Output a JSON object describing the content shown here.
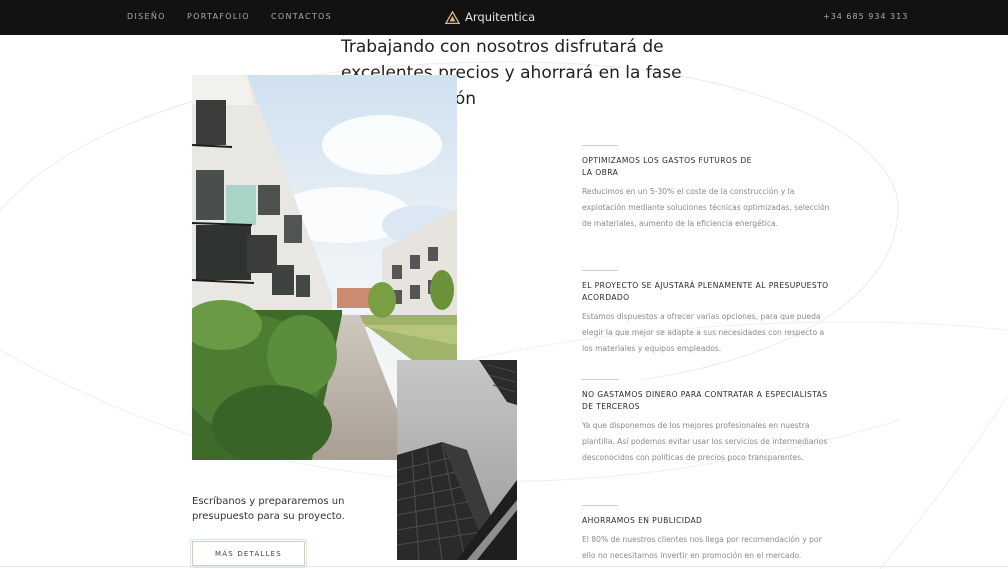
{
  "nav": {
    "links": [
      "DISEÑO",
      "PORTAFOLIO",
      "CONTACTOS"
    ],
    "brand_name": "Arquitentica",
    "phone": "+34 685 934 313"
  },
  "hero": {
    "headline": "Trabajando con nosotros disfrutará de excelentes precios y ahorrará en la fase de construcción"
  },
  "cta": {
    "text": "Escríbanos y prepararemos un presupuesto para su proyecto.",
    "button_label": "MÁS DETALLES"
  },
  "features": [
    {
      "title": "OPTIMIZAMOS LOS GASTOS FUTUROS DE LA OBRA",
      "body": "Reducimos en un 5-30% el coste de la construcción y la explotación mediante soluciones técnicas optimizadas, selección de materiales, aumento de la eficiencia energética."
    },
    {
      "title": "EL PROYECTO SE AJUSTARÁ PLENAMENTE AL PRESUPUESTO ACORDADO",
      "body": "Estamos dispuestos a ofrecer varias opciones, para que pueda elegir la que mejor se adapte a sus necesidades con respecto a los materiales y equipos empleados."
    },
    {
      "title": "NO GASTAMOS DINERO PARA CONTRATAR A ESPECIALISTAS DE TERCEROS",
      "body": "Ya que disponemos de los mejores profesionales en nuestra plantilla. Así podemos evitar usar los servicios de intermediarios desconocidos con políticas de precios poco transparentes."
    },
    {
      "title": "AHORRAMOS EN PUBLICIDAD",
      "body": "El 80% de nuestros clientes nos llega por recomendación y por ello no necesitamos invertir en promoción en el mercado."
    }
  ],
  "colors": {
    "navbar_bg": "#121212",
    "accent_gold": "#d9cbb6",
    "text_muted": "#8a8a8a"
  },
  "icons": {
    "brand_logo": "triangle-a-logo-icon"
  }
}
